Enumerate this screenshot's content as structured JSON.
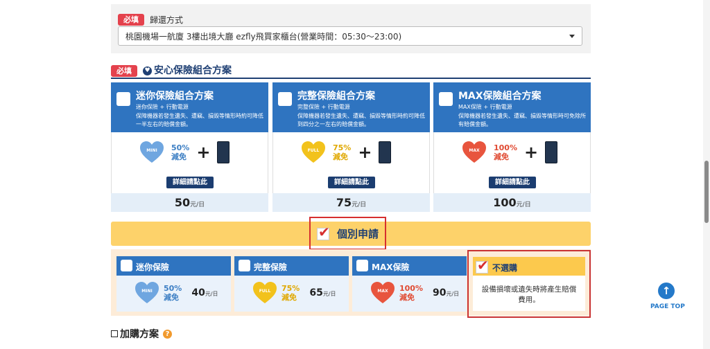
{
  "return_section": {
    "required_badge": "必填",
    "label": "歸還方式",
    "selected": "桃園機場一航廈 3樓出境大廳 ezfly飛買家櫃台(營業時間：05:30～23:00)"
  },
  "insurance": {
    "required_badge": "必填",
    "title": "安心保險組合方案",
    "plans": [
      {
        "name": "迷你保險組合方案",
        "desc1": "迷你保險 + 行動電源",
        "desc2": "保障機器若發生遺失、遭竊、損毀等情形時約可降低一半左右的賠償金額。",
        "badge": "MINI",
        "pct": "50%",
        "waive": "減免",
        "heart_color": "#6fa6e0",
        "pct_color": "#3d7fc4",
        "detail": "詳細請點此",
        "price": "50",
        "unit": "元/日"
      },
      {
        "name": "完整保險組合方案",
        "desc1": "完整保險 + 行動電源",
        "desc2": "保障機器若發生遺失、遭竊、損毀等情形時約可降低到四分之一左右的賠償金額。",
        "badge": "FULL",
        "pct": "75%",
        "waive": "減免",
        "heart_color": "#f2c21c",
        "pct_color": "#e0a800",
        "detail": "詳細請點此",
        "price": "75",
        "unit": "元/日"
      },
      {
        "name": "MAX保險組合方案",
        "desc1": "MAX保險 + 行動電源",
        "desc2": "保障機器若發生遺失、遭竊、損毀等情形時可免除所有賠償金額。",
        "badge": "MAX",
        "pct": "100%",
        "waive": "減免",
        "heart_color": "#e8553e",
        "pct_color": "#e04a32",
        "detail": "詳細請點此",
        "price": "100",
        "unit": "元/日"
      }
    ]
  },
  "individual": {
    "label": "個別申請",
    "plans": [
      {
        "name": "迷你保險",
        "badge": "MINI",
        "pct": "50%",
        "waive": "減免",
        "price": "40",
        "unit": "元/日"
      },
      {
        "name": "完整保險",
        "badge": "FULL",
        "pct": "75%",
        "waive": "減免",
        "price": "65",
        "unit": "元/日"
      },
      {
        "name": "MAX保險",
        "badge": "MAX",
        "pct": "100%",
        "waive": "減免",
        "price": "90",
        "unit": "元/日"
      }
    ],
    "none": {
      "name": "不選購",
      "desc": "設備損壞或遺失時將產生賠償費用。"
    }
  },
  "addon": {
    "title": "加購方案",
    "help": "?"
  },
  "page_top": {
    "label": "PAGE TOP"
  }
}
